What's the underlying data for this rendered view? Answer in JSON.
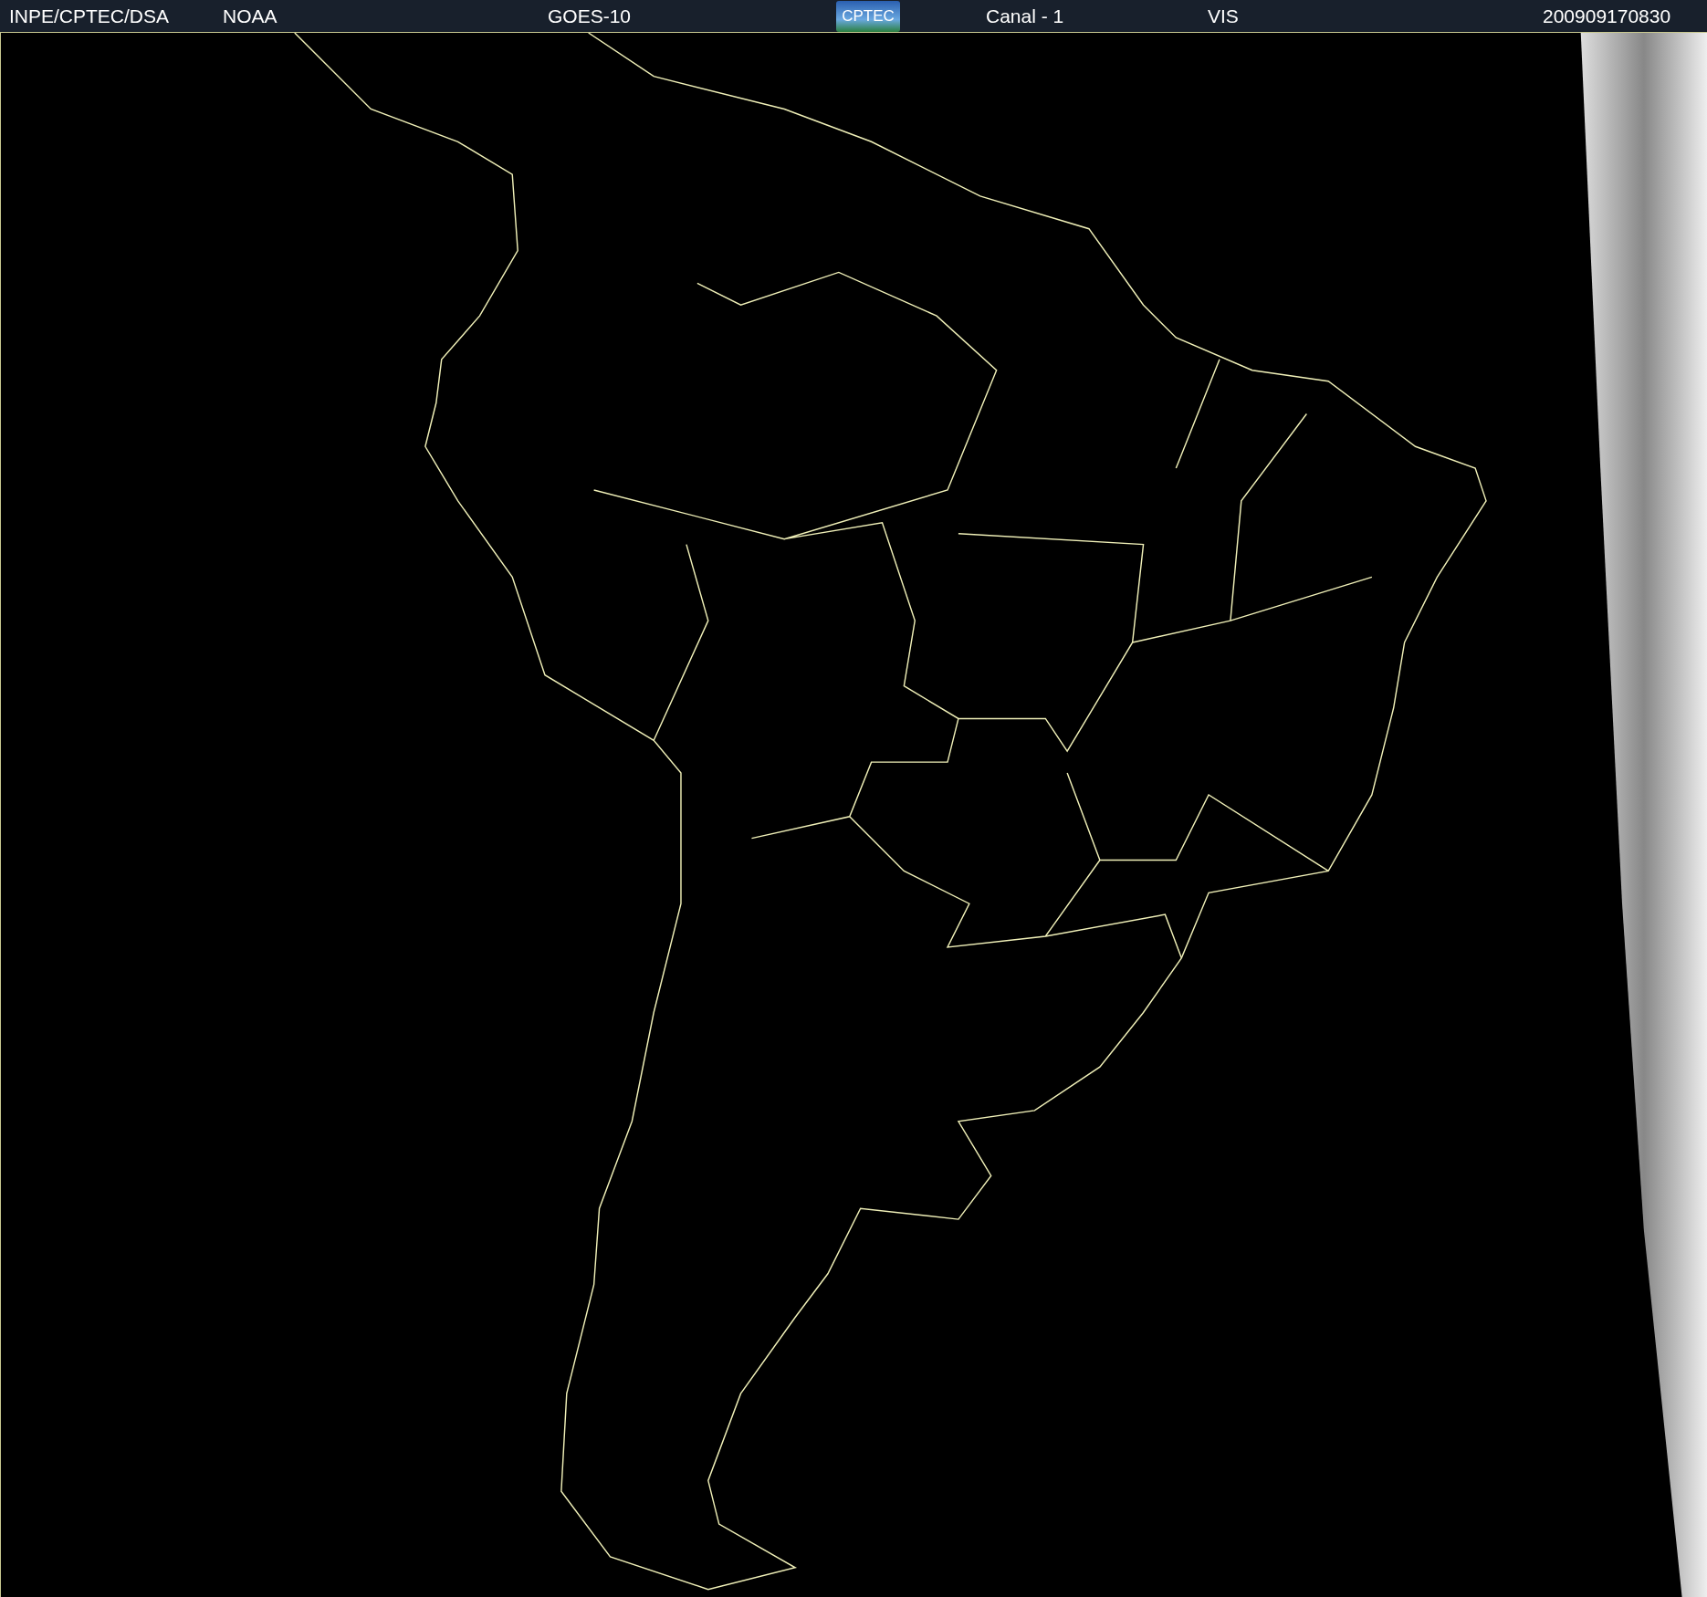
{
  "header": {
    "items": [
      {
        "kind": "text",
        "text": "INPE/CPTEC/DSA"
      },
      {
        "kind": "text",
        "text": "NOAA"
      },
      {
        "kind": "text",
        "text": "GOES-10"
      },
      {
        "kind": "logo",
        "text": "CPTEC"
      },
      {
        "kind": "text",
        "text": "Canal - 1"
      },
      {
        "kind": "text",
        "text": "VIS"
      },
      {
        "kind": "text",
        "text": "200909170830"
      }
    ]
  }
}
